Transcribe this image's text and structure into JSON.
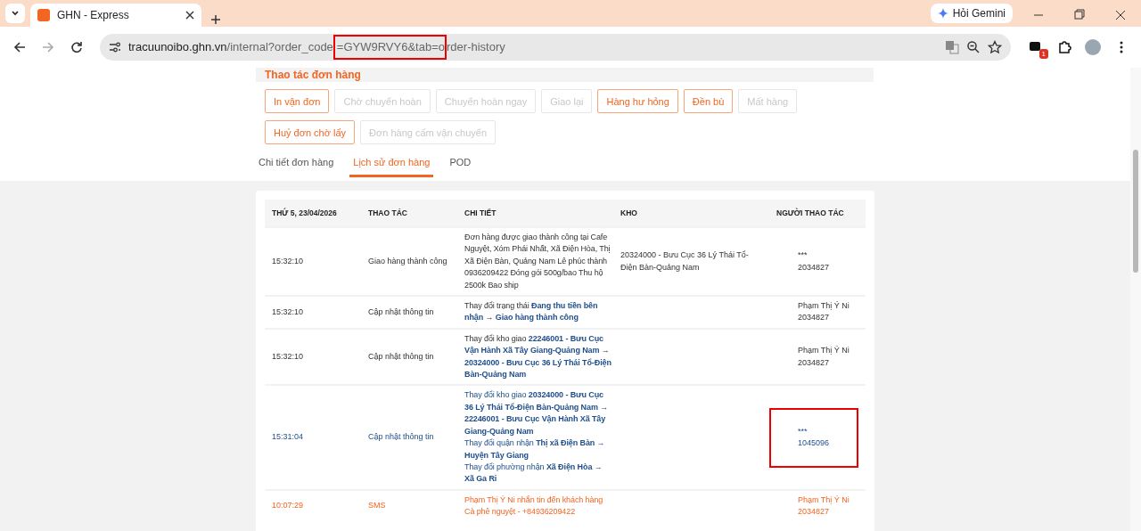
{
  "browser": {
    "tab": {
      "title": "GHN - Express"
    },
    "gemini_button": "Hỏi Gemini",
    "address": [
      {
        "text": "tracuunoibo.ghn.vn",
        "kind": "host",
        "highlighted": false
      },
      {
        "text": "/internal?order_code",
        "kind": "path",
        "highlighted": false
      },
      {
        "text": "=GYW9RVY6&tab=o",
        "kind": "path",
        "highlighted": true
      },
      {
        "text": "rder-history",
        "kind": "path",
        "highlighted": false
      }
    ],
    "extension_badge": "1"
  },
  "actions": {
    "title": "Thao tác đơn hàng",
    "buttons": [
      [
        {
          "label": "In vận đơn",
          "disabled": false
        },
        {
          "label": "Chờ chuyển hoàn",
          "disabled": true
        },
        {
          "label": "Chuyển hoàn ngay",
          "disabled": true
        },
        {
          "label": "Giao lại",
          "disabled": true
        },
        {
          "label": "Hàng hư hỏng",
          "disabled": false
        },
        {
          "label": "Đền bù",
          "disabled": false
        },
        {
          "label": "Mất hàng",
          "disabled": true
        }
      ],
      [
        {
          "label": "Huỷ đơn chờ lấy",
          "disabled": false
        },
        {
          "label": "Đơn hàng cấm vận chuyển",
          "disabled": true
        }
      ]
    ]
  },
  "tabs": [
    {
      "label": "Chi tiết đơn hàng",
      "selected": false
    },
    {
      "label": "Lịch sử đơn hàng",
      "selected": true
    },
    {
      "label": "POD",
      "selected": false
    }
  ],
  "table": {
    "columns": [
      "THỨ 5, 23/04/2026",
      "THAO TÁC",
      "CHI TIẾT",
      "KHO",
      "NGƯỜI THAO TÁC"
    ],
    "rows": [
      {
        "kind": "normal",
        "time": "15:32:10",
        "action": "Giao hàng thành công",
        "details": [
          "Đơn hàng được giao thành công tại Cafe Nguyệt, Xóm Phái Nhất, Xã Điện Hòa, Thị Xã Điện Bàn, Quảng Nam Lê phúc thành 0936209422 Đóng gói 500g/bao Thu hộ 2500k Bao ship"
        ],
        "warehouse": "20324000 - Bưu Cục 36 Lý Thái Tổ-Điện Bàn-Quảng Nam",
        "operator": [
          "***",
          "2034827"
        ],
        "highlighted": false
      },
      {
        "kind": "normal",
        "time": "15:32:10",
        "action": "Cập nhật thông tin",
        "details": [
          "Thay đổi trạng thái **Đang thu tiền bên nhận** → **Giao hàng thành công**"
        ],
        "operator": [
          "Phạm Thị Ý Ni",
          "2034827"
        ],
        "highlighted": false
      },
      {
        "kind": "normal",
        "time": "15:32:10",
        "action": "Cập nhật thông tin",
        "details": [
          "Thay đổi kho giao **22246001 - Bưu Cục Vận Hành Xã Tây Giang-Quảng Nam** → **20324000 - Bưu Cục 36 Lý Thái Tổ-Điện Bàn-Quảng Nam**"
        ],
        "operator": [
          "Phạm Thị Ý Ni",
          "2034827"
        ],
        "highlighted": false
      },
      {
        "kind": "recent",
        "time": "15:31:04",
        "action": "Cập nhật thông tin",
        "details": [
          "Thay đổi kho giao **20324000 - Bưu Cục 36 Lý Thái Tổ-Điện Bàn-Quảng Nam** → **22246001 - Bưu Cục Vận Hành Xã Tây Giang-Quảng Nam**",
          "Thay đổi quận nhận **Thị xã Điện Bàn** → **Huyện Tây Giang**",
          "Thay đổi phường nhận **Xã Điện Hòa** → **Xã Ga Ri**"
        ],
        "operator": [
          "***",
          "1045096"
        ],
        "highlighted": true
      },
      {
        "kind": "sms",
        "time": "10:07:29",
        "action": "SMS",
        "details": [
          "Phạm Thị Ý Ni nhắn tin đến khách hàng Cà phê nguyệt - +84936209422"
        ],
        "operator": [
          "Phạm Thị Ý Ni",
          "2034827"
        ],
        "highlighted": false
      }
    ]
  }
}
